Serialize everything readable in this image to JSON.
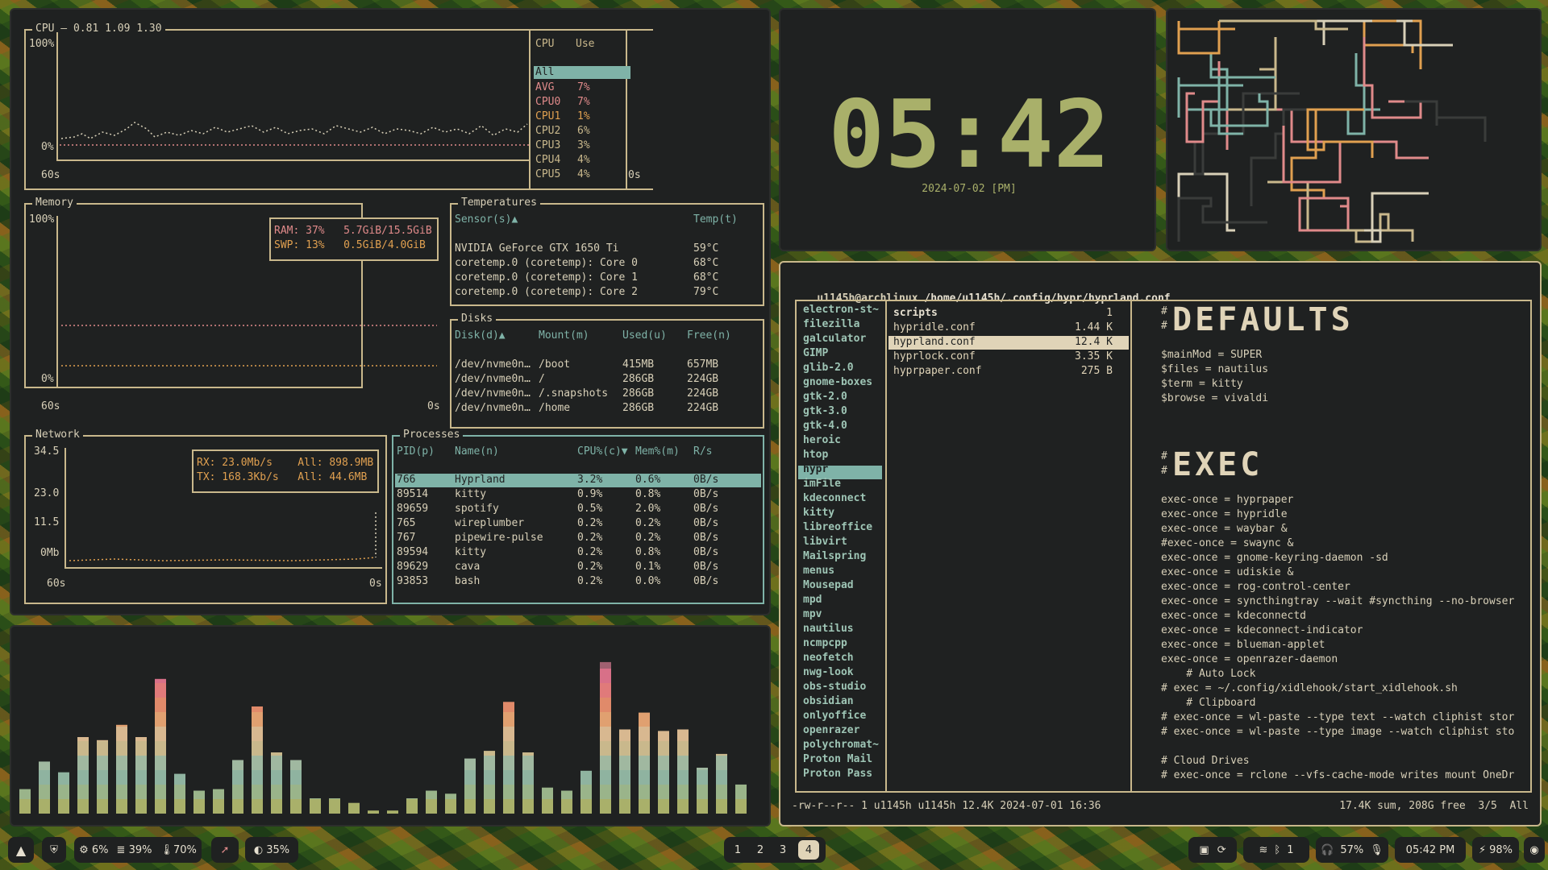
{
  "btop": {
    "cpu": {
      "title": "CPU — 0.81 1.09 1.30",
      "y_top": "100%",
      "y_bottom": "0%",
      "x_left": "60s",
      "x_right": "0s",
      "table_header": [
        "CPU",
        "Use"
      ],
      "rows": [
        {
          "name": "All",
          "use": ""
        },
        {
          "name": "AVG",
          "use": "7%"
        },
        {
          "name": "CPU0",
          "use": "7%"
        },
        {
          "name": "CPU1",
          "use": "1%"
        },
        {
          "name": "CPU2",
          "use": "6%"
        },
        {
          "name": "CPU3",
          "use": "3%"
        },
        {
          "name": "CPU4",
          "use": "4%"
        },
        {
          "name": "CPU5",
          "use": "4%"
        }
      ]
    },
    "memory": {
      "title": "Memory",
      "y_top": "100%",
      "y_bottom": "0%",
      "x_left": "60s",
      "x_right": "0s",
      "ram": "RAM: 37%   5.7GiB/15.5GiB",
      "swp": "SWP: 13%   0.5GiB/4.0GiB"
    },
    "temperatures": {
      "title": "Temperatures",
      "header_sensor": "Sensor(s)▲",
      "header_temp": "Temp(t)",
      "rows": [
        {
          "sensor": "NVIDIA GeForce GTX 1650 Ti",
          "temp": "59°C"
        },
        {
          "sensor": "coretemp.0 (coretemp): Core 0",
          "temp": "68°C"
        },
        {
          "sensor": "coretemp.0 (coretemp): Core 1",
          "temp": "68°C"
        },
        {
          "sensor": "coretemp.0 (coretemp): Core 2",
          "temp": "79°C"
        }
      ]
    },
    "disks": {
      "title": "Disks",
      "header": [
        "Disk(d)▲",
        "Mount(m)",
        "Used(u)",
        "Free(n)"
      ],
      "rows": [
        [
          "/dev/nvme0n…",
          "/boot",
          "415MB",
          "657MB"
        ],
        [
          "/dev/nvme0n…",
          "/",
          "286GB",
          "224GB"
        ],
        [
          "/dev/nvme0n…",
          "/.snapshots",
          "286GB",
          "224GB"
        ],
        [
          "/dev/nvme0n…",
          "/home",
          "286GB",
          "224GB"
        ]
      ]
    },
    "network": {
      "title": "Network",
      "y_labels": [
        "34.5",
        "23.0",
        "11.5",
        "0Mb"
      ],
      "x_left": "60s",
      "x_right": "0s",
      "rx": "RX: 23.0Mb/s    All: 898.9MB",
      "tx": "TX: 168.3Kb/s   All: 44.6MB"
    },
    "processes": {
      "title": "Processes",
      "header": [
        "PID(p)",
        "Name(n)",
        "CPU%(c)▼",
        "Mem%(m)",
        "R/s"
      ],
      "rows": [
        [
          "766",
          "Hyprland",
          "3.2%",
          "0.6%",
          "0B/s"
        ],
        [
          "89514",
          "kitty",
          "0.9%",
          "0.8%",
          "0B/s"
        ],
        [
          "89659",
          "spotify",
          "0.5%",
          "2.0%",
          "0B/s"
        ],
        [
          "765",
          "wireplumber",
          "0.2%",
          "0.2%",
          "0B/s"
        ],
        [
          "767",
          "pipewire-pulse",
          "0.2%",
          "0.2%",
          "0B/s"
        ],
        [
          "89594",
          "kitty",
          "0.2%",
          "0.8%",
          "0B/s"
        ],
        [
          "89629",
          "cava",
          "0.2%",
          "0.1%",
          "0B/s"
        ],
        [
          "93853",
          "bash",
          "0.2%",
          "0.0%",
          "0B/s"
        ]
      ]
    }
  },
  "clock": {
    "time": "05:42",
    "date": "2024-07-02 [PM]"
  },
  "visualizer": {
    "bar_heights": [
      0.16,
      0.34,
      0.27,
      0.5,
      0.48,
      0.58,
      0.5,
      0.88,
      0.26,
      0.15,
      0.16,
      0.35,
      0.7,
      0.4,
      0.35,
      0.1,
      0.1,
      0.07,
      0.02,
      0.02,
      0.1,
      0.15,
      0.13,
      0.36,
      0.41,
      0.73,
      0.4,
      0.17,
      0.15,
      0.28,
      0.99,
      0.55,
      0.66,
      0.54,
      0.55,
      0.3,
      0.39,
      0.19
    ]
  },
  "file_manager": {
    "path_user": "u1145h@archlinux",
    "path": "/home/u1145h/.config/hypr/hyprland.conf",
    "dirs": [
      "electron-st~",
      "filezilla",
      "galculator",
      "GIMP",
      "glib-2.0",
      "gnome-boxes",
      "gtk-2.0",
      "gtk-3.0",
      "gtk-4.0",
      "heroic",
      "htop",
      "hypr",
      "imFile",
      "kdeconnect",
      "kitty",
      "libreoffice",
      "libvirt",
      "Mailspring",
      "menus",
      "Mousepad",
      "mpd",
      "mpv",
      "nautilus",
      "ncmpcpp",
      "neofetch",
      "nwg-look",
      "obs-studio",
      "obsidian",
      "onlyoffice",
      "openrazer",
      "polychromat~",
      "Proton Mail",
      "Proton Pass"
    ],
    "files": [
      {
        "name": "scripts",
        "size": "1"
      },
      {
        "name": "hypridle.conf",
        "size": "1.44 K"
      },
      {
        "name": "hyprland.conf",
        "size": "12.4 K"
      },
      {
        "name": "hyprlock.conf",
        "size": "3.35 K"
      },
      {
        "name": "hyprpaper.conf",
        "size": "275 B"
      }
    ],
    "preview": {
      "hash": "#",
      "heading1": "DEFAULTS",
      "defaults": [
        "$mainMod = SUPER",
        "$files = nautilus",
        "$term = kitty",
        "$browse = vivaldi"
      ],
      "heading2": "EXEC",
      "exec": [
        "exec-once = hyprpaper",
        "exec-once = hypridle",
        "exec-once = waybar &",
        "#exec-once = swaync &",
        "exec-once = gnome-keyring-daemon -sd",
        "exec-once = udiskie &",
        "exec-once = rog-control-center",
        "exec-once = syncthingtray --wait #syncthing --no-browser",
        "exec-once = kdeconnectd",
        "exec-once = kdeconnect-indicator",
        "exec-once = blueman-applet",
        "exec-once = openrazer-daemon",
        "    # Auto Lock",
        "# exec = ~/.config/xidlehook/start_xidlehook.sh",
        "    # Clipboard",
        "# exec-once = wl-paste --type text --watch cliphist stor",
        "# exec-once = wl-paste --type image --watch cliphist sto",
        "",
        "# Cloud Drives",
        "# exec-once = rclone --vfs-cache-mode writes mount OneDr"
      ]
    },
    "status_left": "-rw-r--r-- 1 u1145h u1145h 12.4K 2024-07-01 16:36",
    "status_right": "17.4K sum, 208G free  3/5  All"
  },
  "taskbar": {
    "cpu": "6%",
    "disk": "39%",
    "temp": "70%",
    "brightness": "35%",
    "workspaces": [
      "1",
      "2",
      "3",
      "4"
    ],
    "active_workspace": "4",
    "bluetooth": "1",
    "volume": "57%",
    "time": "05:42 PM",
    "battery": "98%"
  }
}
